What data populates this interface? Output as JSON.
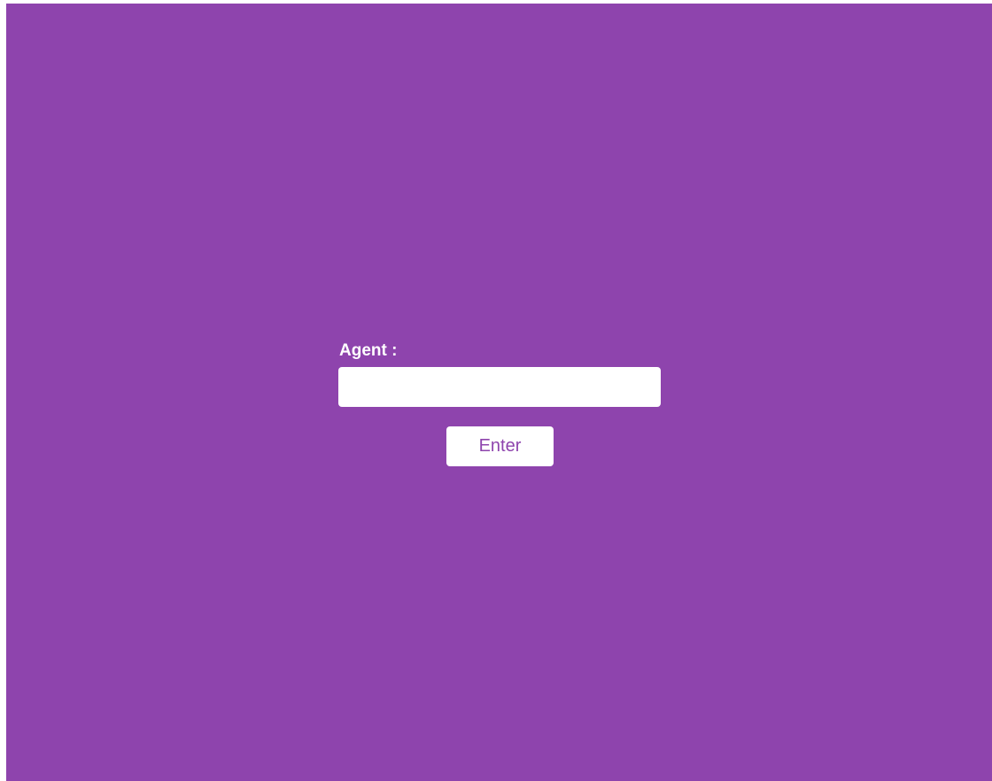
{
  "theme": {
    "background": "#8e44ad",
    "field_background": "#ffffff",
    "button_text_color": "#8e44ad"
  },
  "form": {
    "agent_label": "Agent :",
    "agent_value": "",
    "agent_placeholder": "",
    "enter_label": "Enter"
  }
}
